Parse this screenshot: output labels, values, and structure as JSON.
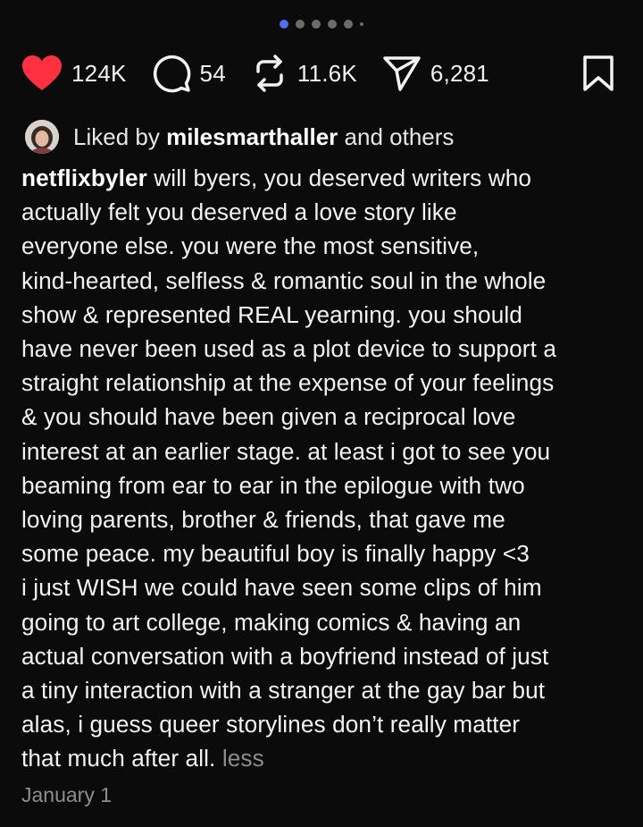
{
  "carousel": {
    "count": 6,
    "active_index": 0
  },
  "actions": {
    "likes": "124K",
    "comments": "54",
    "reposts": "11.6K",
    "shares": "6,281",
    "like_color": "#ff3040"
  },
  "liked_by": {
    "prefix": "Liked by",
    "username": "milesmarthaller",
    "suffix": "and others"
  },
  "post": {
    "username": "netflixbyler",
    "lines": [
      " will byers, you deserved writers who",
      "actually felt you deserved a love story like",
      "everyone else. you were the most sensitive,",
      "kind-hearted, selfless & romantic soul in the whole",
      "show & represented REAL yearning. you should",
      "have never been used as a plot device to support a",
      "straight relationship at the expense of your feelings",
      "& you should have been given a reciprocal love",
      "interest at an earlier stage. at least i got to see you",
      "beaming from ear to ear in the epilogue with two",
      "loving parents, brother & friends, that gave me",
      "some peace. my beautiful boy is finally happy <3",
      "i just WISH we could have seen some clips of him",
      "going to art college, making comics & having an",
      "actual conversation with a boyfriend instead of just",
      "a tiny interaction with a stranger at the gay bar but",
      "alas, i guess queer storylines don’t really matter",
      "that much after all."
    ],
    "less_label": "less",
    "date": "January 1"
  }
}
